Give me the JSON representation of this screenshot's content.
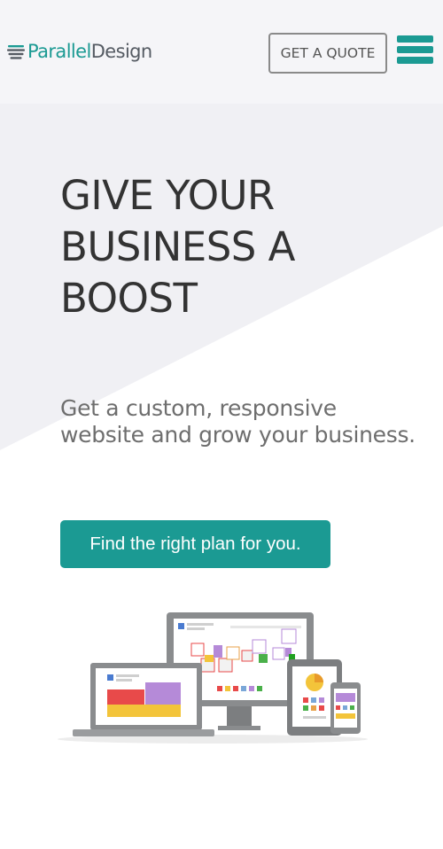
{
  "header": {
    "logo_part1": "Parallel",
    "logo_part2": "Design",
    "quote_button": "GET A QUOTE",
    "menu_icon": "hamburger-menu-icon"
  },
  "hero": {
    "title": "GIVE YOUR BUSINESS A BOOST",
    "subtitle": "Get a custom, responsive website and grow your business.",
    "cta_label": "Find the right plan for you.",
    "illustration": "responsive-devices-illustration"
  },
  "colors": {
    "brand": "#1b9a93",
    "header_bg": "#f5f5f8",
    "hero_band": "#f0f0f4",
    "title_text": "#333333",
    "subtitle_text": "#6e6e6e"
  }
}
